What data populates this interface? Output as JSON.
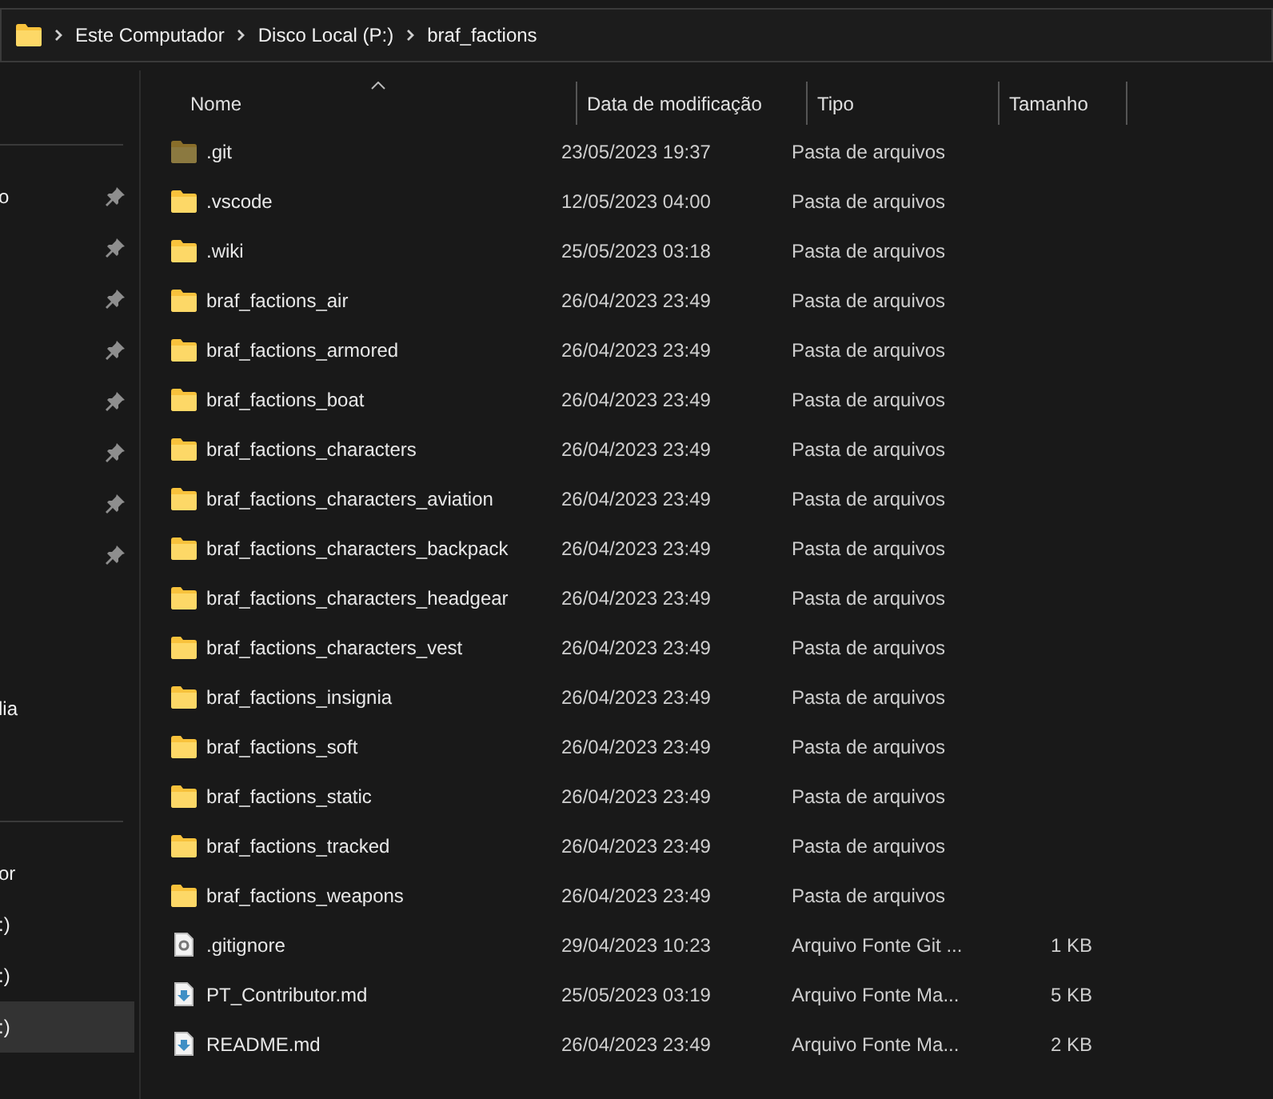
{
  "breadcrumb": [
    "Este Computador",
    "Disco Local (P:)",
    "braf_factions"
  ],
  "sidebar": {
    "sections": [
      {
        "items": [
          {
            "label": "o",
            "pinned": true,
            "selected": false
          },
          {
            "pinned": true,
            "selected": false
          },
          {
            "pinned": true,
            "selected": false
          },
          {
            "pinned": true,
            "selected": false
          },
          {
            "pinned": true,
            "selected": false
          },
          {
            "pinned": true,
            "selected": false
          },
          {
            "pinned": true,
            "selected": false
          },
          {
            "pinned": true,
            "selected": false
          },
          {
            "label": "lia",
            "pinned": false,
            "selected": false
          }
        ]
      },
      {
        "items": [
          {
            "label": "or",
            "pinned": false,
            "selected": false
          },
          {
            "label": ":)",
            "pinned": false,
            "selected": false
          },
          {
            "label": ":)",
            "pinned": false,
            "selected": false
          },
          {
            "label": ":)",
            "pinned": false,
            "selected": true
          }
        ]
      }
    ]
  },
  "columns": [
    {
      "label": "Nome",
      "sorted": true
    },
    {
      "label": "Data de modificação",
      "sorted": false
    },
    {
      "label": "Tipo",
      "sorted": false
    },
    {
      "label": "Tamanho",
      "sorted": false
    }
  ],
  "rows": [
    {
      "kind": "folder",
      "hidden": true,
      "name": ".git",
      "modified": "23/05/2023 19:37",
      "type": "Pasta de arquivos"
    },
    {
      "kind": "folder",
      "hidden": false,
      "name": ".vscode",
      "modified": "12/05/2023 04:00",
      "type": "Pasta de arquivos"
    },
    {
      "kind": "folder",
      "hidden": false,
      "name": ".wiki",
      "modified": "25/05/2023 03:18",
      "type": "Pasta de arquivos"
    },
    {
      "kind": "folder",
      "hidden": false,
      "name": "braf_factions_air",
      "modified": "26/04/2023 23:49",
      "type": "Pasta de arquivos"
    },
    {
      "kind": "folder",
      "hidden": false,
      "name": "braf_factions_armored",
      "modified": "26/04/2023 23:49",
      "type": "Pasta de arquivos"
    },
    {
      "kind": "folder",
      "hidden": false,
      "name": "braf_factions_boat",
      "modified": "26/04/2023 23:49",
      "type": "Pasta de arquivos"
    },
    {
      "kind": "folder",
      "hidden": false,
      "name": "braf_factions_characters",
      "modified": "26/04/2023 23:49",
      "type": "Pasta de arquivos"
    },
    {
      "kind": "folder",
      "hidden": false,
      "name": "braf_factions_characters_aviation",
      "modified": "26/04/2023 23:49",
      "type": "Pasta de arquivos"
    },
    {
      "kind": "folder",
      "hidden": false,
      "name": "braf_factions_characters_backpack",
      "modified": "26/04/2023 23:49",
      "type": "Pasta de arquivos"
    },
    {
      "kind": "folder",
      "hidden": false,
      "name": "braf_factions_characters_headgear",
      "modified": "26/04/2023 23:49",
      "type": "Pasta de arquivos"
    },
    {
      "kind": "folder",
      "hidden": false,
      "name": "braf_factions_characters_vest",
      "modified": "26/04/2023 23:49",
      "type": "Pasta de arquivos"
    },
    {
      "kind": "folder",
      "hidden": false,
      "name": "braf_factions_insignia",
      "modified": "26/04/2023 23:49",
      "type": "Pasta de arquivos"
    },
    {
      "kind": "folder",
      "hidden": false,
      "name": "braf_factions_soft",
      "modified": "26/04/2023 23:49",
      "type": "Pasta de arquivos"
    },
    {
      "kind": "folder",
      "hidden": false,
      "name": "braf_factions_static",
      "modified": "26/04/2023 23:49",
      "type": "Pasta de arquivos"
    },
    {
      "kind": "folder",
      "hidden": false,
      "name": "braf_factions_tracked",
      "modified": "26/04/2023 23:49",
      "type": "Pasta de arquivos"
    },
    {
      "kind": "folder",
      "hidden": false,
      "name": "braf_factions_weapons",
      "modified": "26/04/2023 23:49",
      "type": "Pasta de arquivos"
    },
    {
      "kind": "config",
      "name": ".gitignore",
      "modified": "29/04/2023 10:23",
      "type": "Arquivo Fonte Git ...",
      "size": "1 KB"
    },
    {
      "kind": "markdown",
      "name": "PT_Contributor.md",
      "modified": "25/05/2023 03:19",
      "type": "Arquivo Fonte Ma...",
      "size": "5 KB"
    },
    {
      "kind": "markdown",
      "name": "README.md",
      "modified": "26/04/2023 23:49",
      "type": "Arquivo Fonte Ma...",
      "size": "2 KB"
    }
  ]
}
